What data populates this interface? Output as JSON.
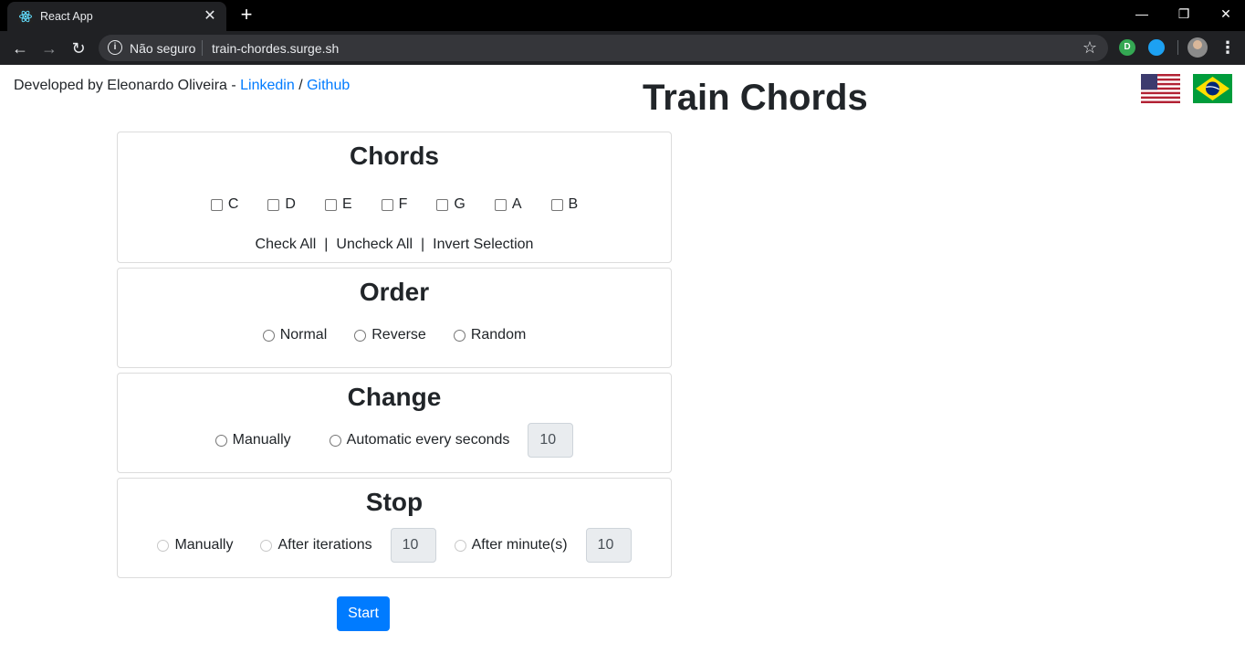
{
  "browser": {
    "tab_title": "React App",
    "security_label": "Não seguro",
    "url": "train-chordes.surge.sh"
  },
  "page": {
    "credit_prefix": "Developed by Eleonardo Oliveira - ",
    "linkedin": "Linkedin",
    "credit_sep": " / ",
    "github": "Github",
    "title": "Train Chords"
  },
  "chords": {
    "heading": "Chords",
    "items": [
      "C",
      "D",
      "E",
      "F",
      "G",
      "A",
      "B"
    ],
    "check_all": "Check All",
    "uncheck_all": "Uncheck All",
    "invert": "Invert Selection",
    "pipe": "|"
  },
  "order": {
    "heading": "Order",
    "options": [
      "Normal",
      "Reverse",
      "Random"
    ]
  },
  "change": {
    "heading": "Change",
    "manual": "Manually",
    "auto": "Automatic every seconds",
    "seconds_value": "10"
  },
  "stop": {
    "heading": "Stop",
    "manual": "Manually",
    "iterations": "After iterations",
    "iterations_value": "10",
    "minutes": "After minute(s)",
    "minutes_value": "10"
  },
  "start_label": "Start"
}
